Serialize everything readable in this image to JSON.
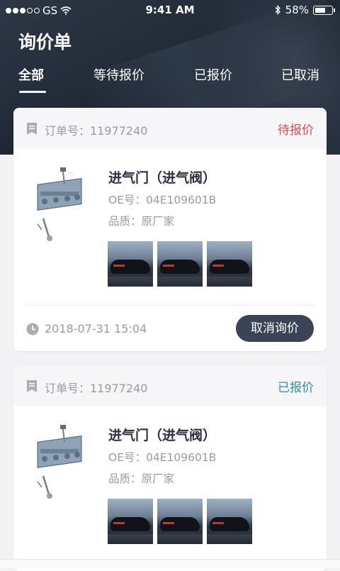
{
  "status_bar": {
    "carrier": "GS",
    "time": "9:41 AM",
    "battery": "58%",
    "battery_level": 0.58,
    "signal_dots_filled": 3,
    "signal_dots_total": 5
  },
  "header": {
    "title": "询价单"
  },
  "tabs": [
    {
      "label": "全部",
      "active": true
    },
    {
      "label": "等待报价",
      "active": false
    },
    {
      "label": "已报价",
      "active": false
    },
    {
      "label": "已取消",
      "active": false
    }
  ],
  "orders": [
    {
      "order_label": "订单号：11977240",
      "status": "待报价",
      "status_color": "#e04b4b",
      "part_name": "进气门（进气阀）",
      "oe": "OE号：04E109601B",
      "quality": "品质：原厂家",
      "time": "2018-07-31 15:04",
      "action_label": "取消询价"
    },
    {
      "order_label": "订单号：11977240",
      "status": "已报价",
      "status_color": "#2e8fa0",
      "part_name": "进气门（进气阀）",
      "oe": "OE号：04E109601B",
      "quality": "品质：原厂家"
    }
  ],
  "colors": {
    "accent_dark": "#3a4456",
    "pending": "#e04b4b",
    "quoted": "#2e8fa0"
  }
}
